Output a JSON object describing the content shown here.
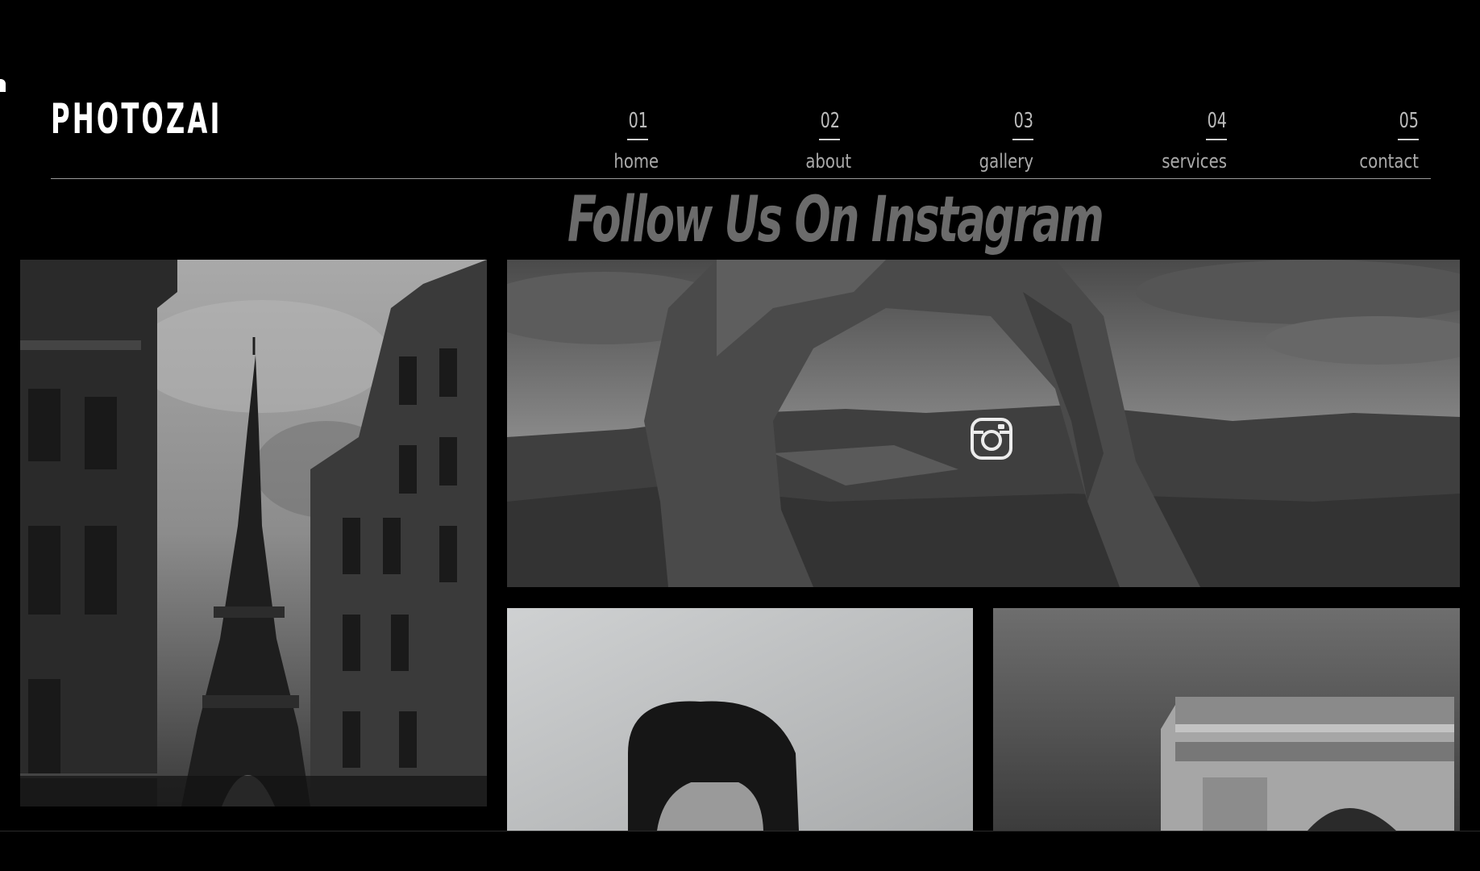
{
  "brand": {
    "logo_text": "PHOTOZAI"
  },
  "nav": {
    "items": [
      {
        "number": "01",
        "label": "home"
      },
      {
        "number": "02",
        "label": "about"
      },
      {
        "number": "03",
        "label": "gallery"
      },
      {
        "number": "04",
        "label": "services"
      },
      {
        "number": "05",
        "label": "contact"
      }
    ]
  },
  "instagram": {
    "title": "Follow Us On Instagram",
    "icon": "instagram-icon",
    "photos": [
      {
        "subject": "eiffel-tower"
      },
      {
        "subject": "rock-arch"
      },
      {
        "subject": "portrait"
      },
      {
        "subject": "arc-de-triomphe"
      }
    ]
  },
  "colors": {
    "background": "#000000",
    "text": "#ffffff",
    "muted_text": "#aaaaaa",
    "title": "#6b6b6b"
  }
}
